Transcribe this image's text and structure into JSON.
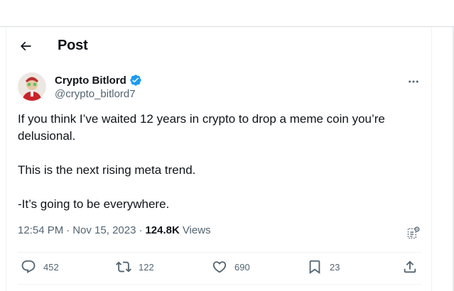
{
  "header": {
    "title": "Post"
  },
  "author": {
    "name": "Crypto Bitlord",
    "handle": "@crypto_bitlord7"
  },
  "tweet": {
    "text": "If you think I’ve waited 12 years in crypto to drop a meme coin you’re delusional.\n\nThis is the next rising meta trend.\n\n-It’s going to be everywhere.",
    "time": "12:54 PM",
    "date": "Nov 15, 2023",
    "separator": "·",
    "views": "124.8K",
    "views_label": "Views"
  },
  "actions": {
    "replies": "452",
    "reposts": "122",
    "likes": "690",
    "bookmarks": "23"
  },
  "colors": {
    "verified": "#1d9bf0",
    "secondary_text": "#536471",
    "primary_text": "#0f1419"
  },
  "icons": [
    "back-arrow-icon",
    "verified-badge-icon",
    "more-icon",
    "grok-icon",
    "reply-icon",
    "repost-icon",
    "like-icon",
    "bookmark-icon",
    "share-icon"
  ]
}
